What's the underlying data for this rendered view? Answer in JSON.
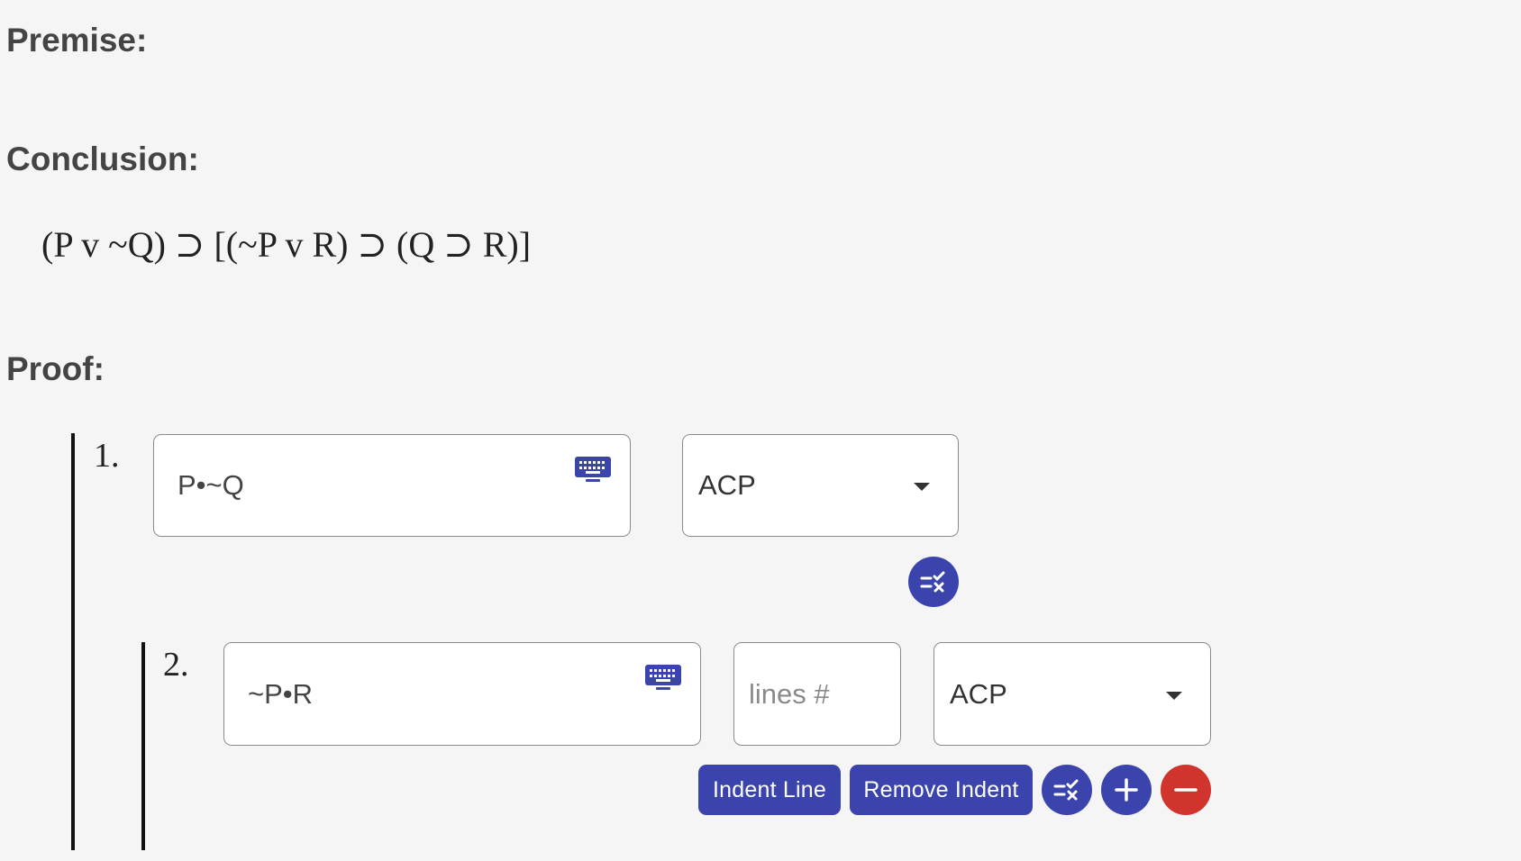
{
  "headings": {
    "premise": "Premise:",
    "conclusion": "Conclusion:",
    "proof": "Proof:"
  },
  "conclusion": {
    "formula": "(P v ~Q) ⊃ [(~P v R) ⊃ (Q ⊃ R)]"
  },
  "proof": {
    "lines": [
      {
        "number": "1.",
        "formula": "P•~Q",
        "justification": "ACP"
      },
      {
        "number": "2.",
        "formula": "~P•R",
        "lines_placeholder": "lines #",
        "justification": "ACP"
      }
    ],
    "buttons": {
      "indent": "Indent Line",
      "remove_indent": "Remove Indent"
    }
  },
  "colors": {
    "accent": "#3b44ad",
    "danger": "#d0342c",
    "background": "#f5f5f5"
  }
}
